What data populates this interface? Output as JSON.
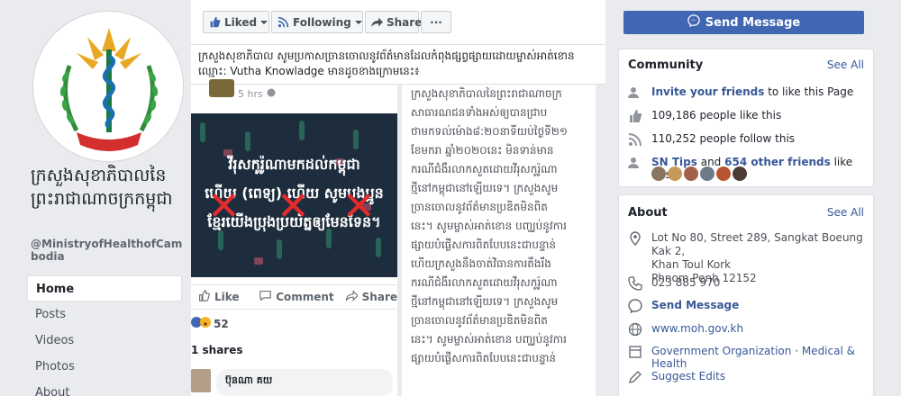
{
  "profile": {
    "name": "ក្រសួងសុខាភិបាលនៃព្រះរាជាណាចក្រកម្ពុជា",
    "handle": "@MinistryofHealthofCambodia"
  },
  "nav": {
    "items": [
      {
        "label": "Home"
      },
      {
        "label": "Posts"
      },
      {
        "label": "Videos"
      },
      {
        "label": "Photos"
      },
      {
        "label": "About"
      }
    ]
  },
  "toolbar": {
    "liked_label": "Liked",
    "following_label": "Following",
    "share_label": "Share",
    "more_label": "···"
  },
  "notice": {
    "text": "ក្រសួងសុខាភិបាល សូមប្រកាសច្រានចោលនូវព័ត៌មានដែលកំពុងផ្សព្វផ្សាយដោយម្ចាស់អាត់ខោនឈ្មោះ: Vutha Knowladge មានដូចខាងក្រោមនេះ៖"
  },
  "post": {
    "time": "5 hrs",
    "image_line1": "វីរុសកូរ៉ូណាមកដល់កម្ពុជា",
    "image_line2": "ហើយ (ពេទ្យ) ហើយ សូមបងប្អូន",
    "image_line3": "ខ្មែរយើងប្រុងប្រយ័ត្នឲ្យមែនទែន។",
    "like_label": "Like",
    "comment_label": "Comment",
    "share_label": "Share",
    "reactions_count": "52",
    "shares_text": "1 shares",
    "commenter": "ប៊ុនណា គយ"
  },
  "textpost": {
    "lines": [
      "ក្រសួងសុខាភិបាលនៃព្រះរាជាណាចក្រ",
      "សាធារណជនទាំងអស់ឲ្យបានជ្រាប",
      "ថាមកទល់ម៉ោង៨:២០នាទីយប់ថ្ងៃទី២១",
      "ខែមករា ឆ្នាំ២០២០នេះ មិនទាន់មាន",
      "ករណីជំងឺរលាកសួតដោយវីរុសកូរ៉ូណា",
      "ថ្មីនៅកម្ពុជានៅឡើយទេ។ ក្រសួងសូម",
      "ច្រានចោលនូវព័ត៌មានប្រឌិតមិនពិត",
      "នេះ។ សូមម្ចាស់អាត់ខោន បញ្ឈប់នូវការ",
      "ផ្សាយបំផ្លើសការពិតបែបនេះជាបន្ទាន់",
      "ហើយក្រសួងនឹងចាត់វិធានការតឹងរឹង",
      "ករណីជំងឺរលាកសួតដោយវីរុសកូរ៉ូណា",
      "ថ្មីនៅកម្ពុជានៅឡើយទេ។ ក្រសួងសូម",
      "ច្រានចោលនូវព័ត៌មានប្រឌិតមិនពិត",
      "នេះ។ សូមម្ចាស់អាត់ខោន បញ្ឈប់នូវការ",
      "ផ្សាយបំផ្លើសការពិតបែបនេះជាបន្ទាន់"
    ]
  },
  "send_message": {
    "label": "Send Message"
  },
  "community": {
    "title": "Community",
    "see_all": "See All",
    "invite_link": "Invite your friends",
    "invite_suffix": " to like this Page",
    "likes": "109,186 people like this",
    "follows": "110,252 people follow this",
    "friends_name": "SN Tips",
    "friends_and": " and ",
    "friends_others": "654 other friends",
    "friends_suffix": " like this"
  },
  "about": {
    "title": "About",
    "see_all": "See All",
    "address_line1": "Lot No 80, Street 289, Sangkat Boeung Kak 2,",
    "address_line2": "Khan Toul Kork",
    "address_line3": "Phnom Penh 12152",
    "phone": "023 885 970",
    "send_message": "Send Message",
    "website": "www.moh.gov.kh",
    "category1": "Government Organization",
    "category_sep": " · ",
    "category2": "Medical & Health",
    "suggest": "Suggest Edits"
  },
  "colors": {
    "brand": "#4267b2",
    "link": "#385898",
    "page_bg": "#e9ebee",
    "x_mark": "#e32b2b"
  }
}
